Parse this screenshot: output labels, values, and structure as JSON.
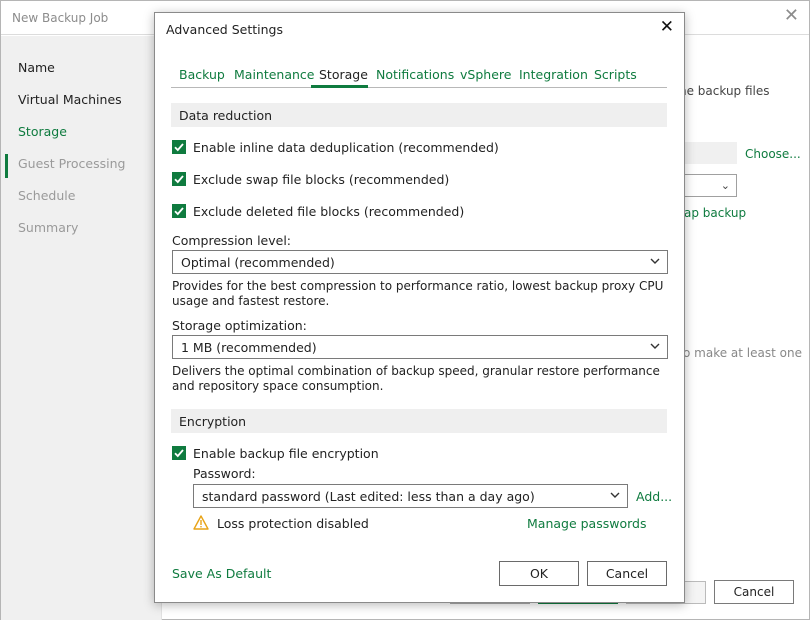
{
  "background_window": {
    "title": "New Backup Job",
    "steps": [
      {
        "label": "Name",
        "state": "active"
      },
      {
        "label": "Virtual Machines",
        "state": "active"
      },
      {
        "label": "Storage",
        "state": "current"
      },
      {
        "label": "Guest Processing",
        "state": "disabled"
      },
      {
        "label": "Schedule",
        "state": "disabled"
      },
      {
        "label": "Summary",
        "state": "disabled"
      }
    ],
    "partial_text_backup_files": "ne backup files",
    "choose_link": "Choose...",
    "partial_link_backup": "ap backup",
    "partial_text_make": "o make at least one",
    "cancel_button": "Cancel"
  },
  "dialog": {
    "title": "Advanced Settings",
    "tabs": [
      {
        "label": "Backup",
        "active": false
      },
      {
        "label": "Maintenance",
        "active": false
      },
      {
        "label": "Storage",
        "active": true
      },
      {
        "label": "Notifications",
        "active": false
      },
      {
        "label": "vSphere",
        "active": false
      },
      {
        "label": "Integration",
        "active": false
      },
      {
        "label": "Scripts",
        "active": false
      }
    ],
    "data_reduction": {
      "header": "Data reduction",
      "checkboxes": [
        {
          "label": "Enable inline data deduplication (recommended)",
          "checked": true
        },
        {
          "label": "Exclude swap file blocks (recommended)",
          "checked": true
        },
        {
          "label": "Exclude deleted file blocks (recommended)",
          "checked": true
        }
      ],
      "compression_label": "Compression level:",
      "compression_value": "Optimal (recommended)",
      "compression_desc": "Provides for the best compression to performance ratio, lowest backup proxy CPU usage and fastest restore.",
      "optimization_label": "Storage optimization:",
      "optimization_value": "1 MB (recommended)",
      "optimization_desc": "Delivers the optimal combination of backup speed, granular restore performance and repository space consumption."
    },
    "encryption": {
      "header": "Encryption",
      "enable_label": "Enable backup file encryption",
      "enable_checked": true,
      "password_label": "Password:",
      "password_value": "standard password (Last edited: less than a day ago)",
      "add_link": "Add...",
      "warning_text": "Loss protection disabled",
      "manage_link": "Manage passwords"
    },
    "footer": {
      "save_default": "Save As Default",
      "ok": "OK",
      "cancel": "Cancel"
    }
  },
  "colors": {
    "accent": "#0f7b3f",
    "warning": "#e8a317"
  },
  "icons": [
    "close-icon",
    "checkmark-icon",
    "chevron-down-icon",
    "warning-icon"
  ]
}
